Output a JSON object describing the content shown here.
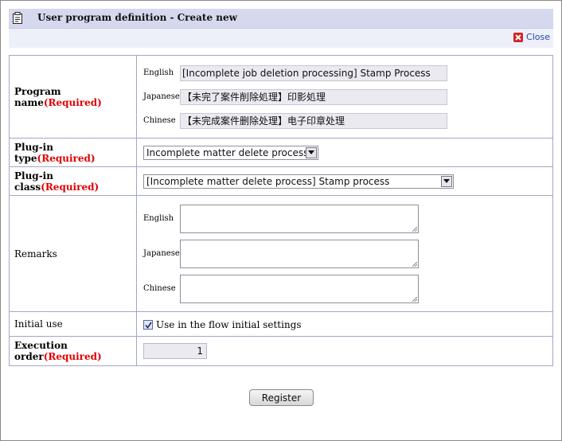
{
  "header": {
    "title": "User program definition - Create new",
    "close_label": "Close"
  },
  "form": {
    "program_name": {
      "label": "Program name",
      "required": "(Required)",
      "values": [
        {
          "lang": "English",
          "value": "[Incomplete job deletion processing] Stamp Process"
        },
        {
          "lang": "Japanese",
          "value": "【未完了案件削除処理】印影処理"
        },
        {
          "lang": "Chinese",
          "value": "【未完成案件删除处理】电子印章处理"
        }
      ]
    },
    "plugin_type": {
      "label": "Plug-in type",
      "required": "(Required)",
      "selected": "Incomplete matter delete process"
    },
    "plugin_class": {
      "label": "Plug-in class",
      "required": "(Required)",
      "selected": "[Incomplete matter delete process] Stamp process"
    },
    "remarks": {
      "label": "Remarks",
      "langs": [
        "English",
        "Japanese",
        "Chinese"
      ]
    },
    "initial_use": {
      "label": "Initial use",
      "checkbox_label": "Use in the flow initial settings",
      "checked": true
    },
    "execution_order": {
      "label": "Execution order",
      "required": "(Required)",
      "value": "1"
    }
  },
  "actions": {
    "register_label": "Register"
  },
  "icons": {
    "title": "clipboard-icon",
    "close": "close-x-icon",
    "select_arrow": "chevron-down-icon",
    "checkbox": "checkmark-icon"
  },
  "colors": {
    "title_bar": "#d6d9ee",
    "required_text": "#e00000",
    "border": "#a3a6c8",
    "close_link": "#2244aa",
    "close_icon": "#d42020"
  }
}
